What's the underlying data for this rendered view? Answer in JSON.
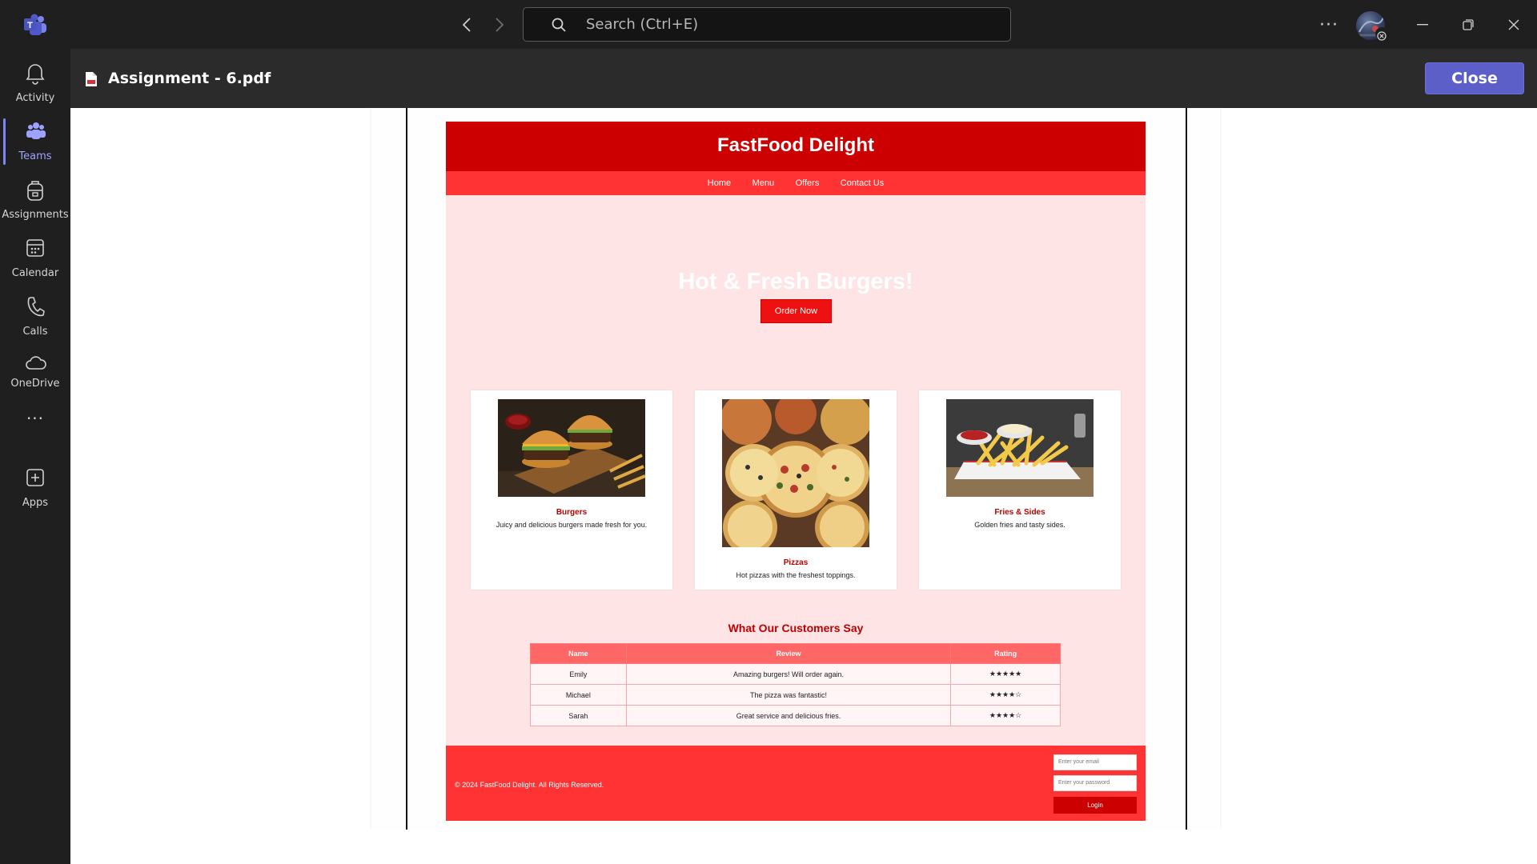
{
  "window": {
    "search_placeholder": "Search (Ctrl+E)",
    "more_label": "···"
  },
  "rail": {
    "items": [
      {
        "label": "Activity"
      },
      {
        "label": "Teams"
      },
      {
        "label": "Assignments"
      },
      {
        "label": "Calendar"
      },
      {
        "label": "Calls"
      },
      {
        "label": "OneDrive"
      },
      {
        "label": "···"
      },
      {
        "label": "Apps"
      }
    ]
  },
  "docbar": {
    "title": "Assignment - 6.pdf",
    "close_label": "Close"
  },
  "site": {
    "title": "FastFood Delight",
    "nav": [
      "Home",
      "Menu",
      "Offers",
      "Contact Us"
    ],
    "hero_title": "Hot & Fresh Burgers!",
    "order_button": "Order Now",
    "cards": [
      {
        "title": "Burgers",
        "desc": "Juicy and delicious burgers made fresh for you."
      },
      {
        "title": "Pizzas",
        "desc": "Hot pizzas with the freshest toppings."
      },
      {
        "title": "Fries & Sides",
        "desc": "Golden fries and tasty sides."
      }
    ],
    "reviews_title": "What Our Customers Say",
    "table": {
      "headers": [
        "Name",
        "Review",
        "Rating"
      ],
      "rows": [
        [
          "Emily",
          "Amazing burgers! Will order again.",
          "★★★★★"
        ],
        [
          "Michael",
          "The pizza was fantastic!",
          "★★★★☆"
        ],
        [
          "Sarah",
          "Great service and delicious fries.",
          "★★★★☆"
        ]
      ]
    },
    "footer": {
      "copyright": "© 2024 FastFood Delight. All Rights Reserved.",
      "email_placeholder": "Enter your email",
      "password_placeholder": "Enter your password",
      "login_label": "Login"
    }
  },
  "colors": {
    "teams_accent": "#5b5fc7",
    "site_header": "#cc0000",
    "site_nav": "#ff3333",
    "site_bg": "#ffe4e6"
  }
}
